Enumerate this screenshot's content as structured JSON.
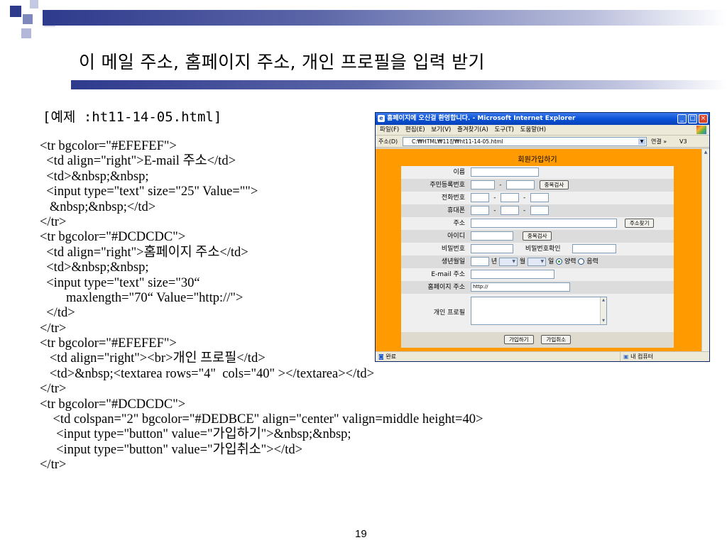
{
  "slide": {
    "title": "이 메일 주소, 홈페이지 주소, 개인 프로필을 입력 받기",
    "example_title": "[예제 :ht11-14-05.html]",
    "page_number": "19",
    "code_lines": [
      "<tr bgcolor=\"#EFEFEF\">",
      "  <td align=\"right\">E-mail 주소</td>",
      "  <td>&nbsp;&nbsp;",
      "  <input type=\"text\" size=\"25\" Value=\"\">",
      "   &nbsp;&nbsp;</td>",
      "</tr>",
      "<tr bgcolor=\"#DCDCDC\">",
      "  <td align=\"right\">홈페이지 주소</td>",
      "  <td>&nbsp;&nbsp;",
      "  <input type=\"text\" size=\"30“",
      "        maxlength=\"70“ Value=\"http://\">",
      "  </td>",
      "</tr>",
      "<tr bgcolor=\"#EFEFEF\">",
      "   <td align=\"right\"><br>개인 프로필</td>",
      "   <td>&nbsp;<textarea rows=\"4\"  cols=\"40\" ></textarea></td>",
      "</tr>",
      "<tr bgcolor=\"#DCDCDC\">",
      "    <td colspan=\"2\" bgcolor=\"#DEDBCE\" align=\"center\" valign=middle height=40>",
      "     <input type=\"button\" value=\"가입하기\">&nbsp;&nbsp;",
      "     <input type=\"button\" value=\"가입취소\"></td>",
      "</tr>"
    ]
  },
  "browser": {
    "window_title": "홈페이지에 오신걸 환영합니다. - Microsoft Internet Explorer",
    "menu_items": [
      "파일(F)",
      "편집(E)",
      "보기(V)",
      "즐겨찾기(A)",
      "도구(T)",
      "도움말(H)"
    ],
    "address_label": "주소(D)",
    "address_value": "C:₩HTML₩11장₩ht11-14-05.html",
    "links_label": "연결",
    "links_chevron": "»",
    "toolbar_v3": "V3",
    "status_text": "완료",
    "status_zone": "내 컴퓨터",
    "background_color": "#FF9B00"
  },
  "form": {
    "title": "회원가입하기",
    "labels": {
      "name": "이름",
      "ssn": "주민등록번호",
      "phone": "전화번호",
      "mobile": "휴대폰",
      "address": "주소",
      "id": "아이디",
      "password": "비밀번호",
      "password_confirm": "비밀번호확인",
      "birth": "생년월일",
      "email": "E-mail 주소",
      "homepage": "홈페이지 주소",
      "profile": "개인 프로필"
    },
    "separator": "-",
    "ssn_check_button": "중복검사",
    "address_search_button": "주소찾기",
    "id_check_button": "중복검사",
    "birth_year_suffix": "년",
    "birth_month_suffix": "월",
    "birth_day_suffix": "일",
    "calendar_solar": "양력",
    "calendar_lunar": "음력",
    "homepage_value": "http://",
    "submit_button": "가입하기",
    "cancel_button": "가입취소",
    "row_colors": {
      "light": "#EFEFEF",
      "dark": "#DCDCDC",
      "buttons": "#DEDBCE"
    }
  }
}
